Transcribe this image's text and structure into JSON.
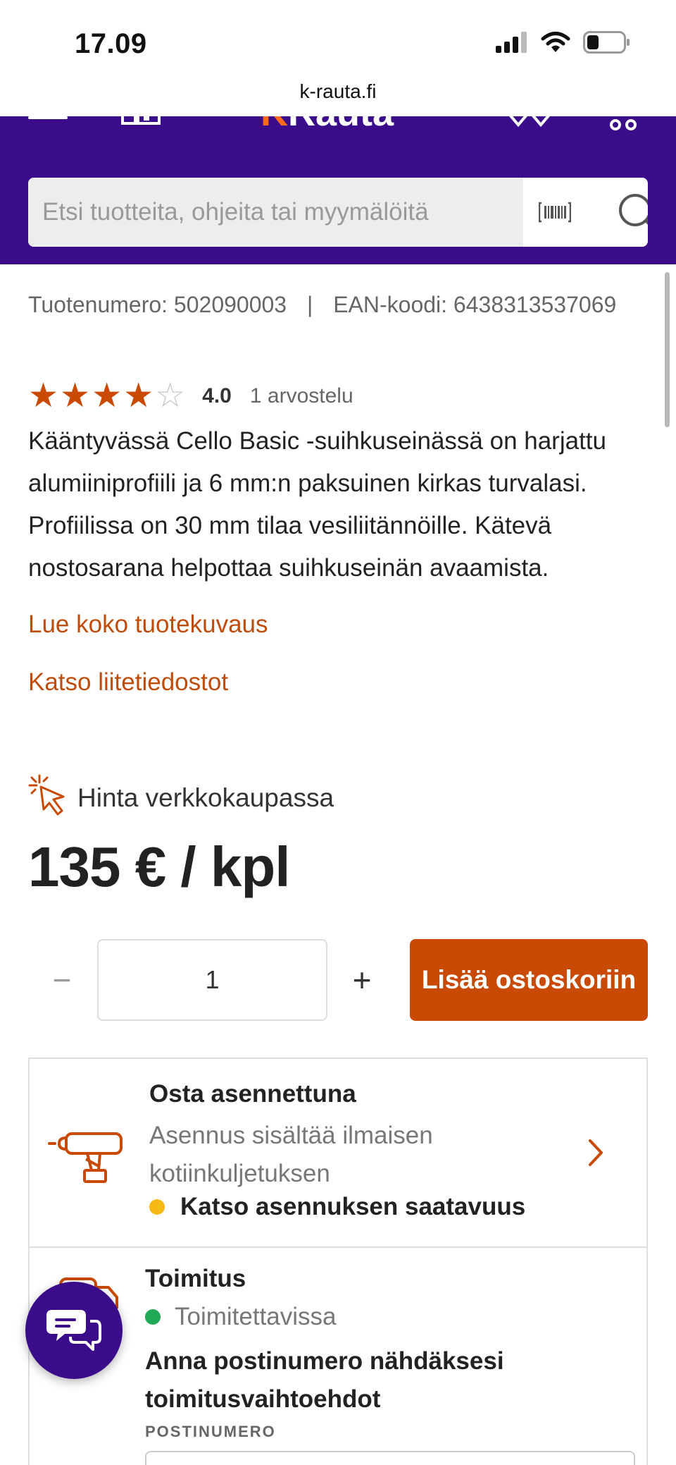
{
  "status_bar": {
    "time": "17.09",
    "url": "k-rauta.fi"
  },
  "header": {
    "logo_prefix": "K",
    "logo_text": "Rauta",
    "brand_color": "#3a0c8a",
    "accent_color": "#c84a05",
    "icons": [
      "menu-icon",
      "store-icon",
      "user-icon",
      "cart-icon"
    ]
  },
  "search": {
    "placeholder": "Etsi tuotteita, ohjeita tai myymälöitä",
    "barcode_icon": "barcode-icon",
    "search_icon": "search-icon"
  },
  "product": {
    "product_number": "Tuotenumero: 502090003",
    "separator": "|",
    "ean": "EAN-koodi: 6438313537069",
    "rating": 4,
    "rating_max": 5,
    "rating_value": "4.0",
    "rating_count": "1 arvostelu",
    "description": "Kääntyvässä Cello Basic -suihkuseinässä on harjattu alumiiniprofiili ja 6 mm:n paksuinen kirkas turvalasi. Profiilissa on 30 mm tilaa vesiliitännöille. Kätevä nostosarana helpottaa suihkuseinän avaamista.",
    "read_more": "Lue koko tuotekuvaus",
    "attachments": "Katso liitetiedostot"
  },
  "price": {
    "label": "Hinta verkkokaupassa",
    "value": "135 € / kpl"
  },
  "purchase": {
    "minus": "−",
    "quantity": "1",
    "plus": "+",
    "add_to_cart": "Lisää ostoskoriin"
  },
  "install": {
    "title": "Osta asennettuna",
    "description": "Asennus sisältää ilmaisen kotiinkuljetuksen",
    "availability": "Katso asennuksen saatavuus",
    "status_color": "#f6b812"
  },
  "delivery": {
    "title": "Toimitus",
    "status": "Toimitettavissa",
    "status_color": "#1fa855",
    "prompt": "Anna postinumero nähdäksesi toimitusvaihtoehdot",
    "postal_label": "POSTINUMERO"
  }
}
